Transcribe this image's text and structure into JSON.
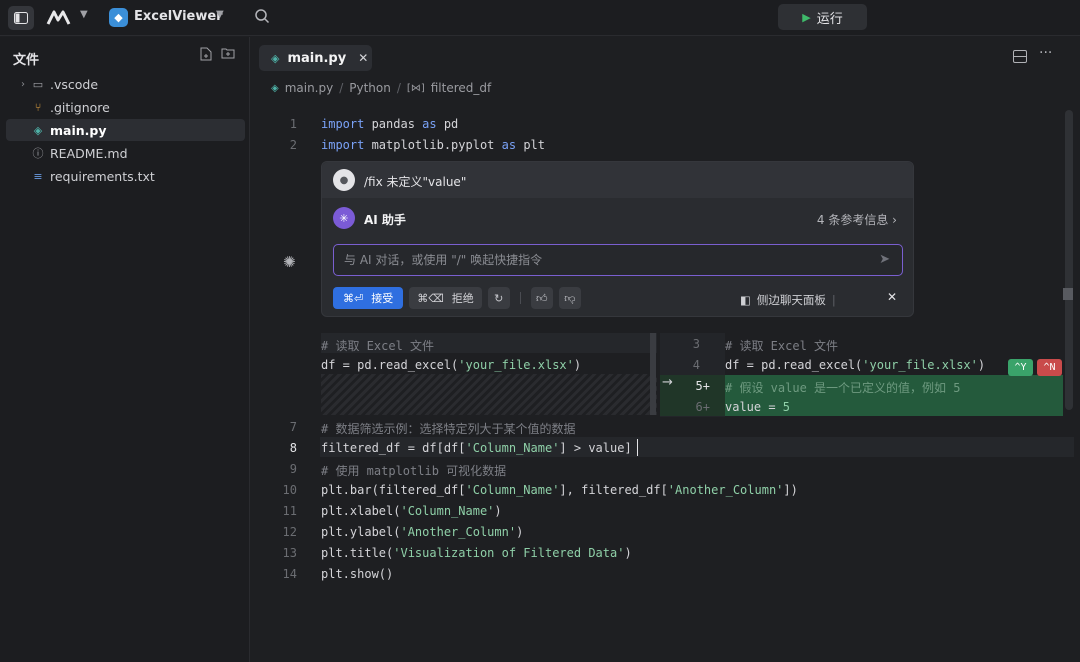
{
  "titlebar": {
    "project_name": "ExcelViewer",
    "run_label": "运行"
  },
  "sidebar": {
    "title": "文件",
    "items": [
      {
        "label": ".vscode",
        "type": "folder"
      },
      {
        "label": ".gitignore",
        "type": "git"
      },
      {
        "label": "main.py",
        "type": "python",
        "selected": true
      },
      {
        "label": "README.md",
        "type": "info"
      },
      {
        "label": "requirements.txt",
        "type": "text"
      }
    ]
  },
  "editor": {
    "tab_label": "main.py",
    "breadcrumb": [
      "main.py",
      "Python",
      "filtered_df"
    ],
    "lines": {
      "l1": {
        "num": "1"
      },
      "l2": {
        "num": "2"
      },
      "l7": {
        "num": "7"
      },
      "l8": {
        "num": "8"
      },
      "l9": {
        "num": "9"
      },
      "l10": {
        "num": "10"
      },
      "l11": {
        "num": "11"
      },
      "l12": {
        "num": "12"
      },
      "l13": {
        "num": "13"
      },
      "l14": {
        "num": "14"
      }
    },
    "diff_new_nums": [
      "3",
      "4",
      "5+",
      "6+"
    ],
    "accept_key": "^Y",
    "reject_key": "^N"
  },
  "ai": {
    "command": "/fix 未定义\"value\"",
    "title": "AI 助手",
    "refs": "4 条参考信息 ›",
    "input_placeholder": "与 AI 对话，或使用 \"/\" 唤起快捷指令",
    "accept_label": "接受",
    "accept_key": "⌘⏎",
    "reject_label": "拒绝",
    "reject_key": "⌘⌫",
    "side_chat_label": "侧边聊天面板"
  }
}
